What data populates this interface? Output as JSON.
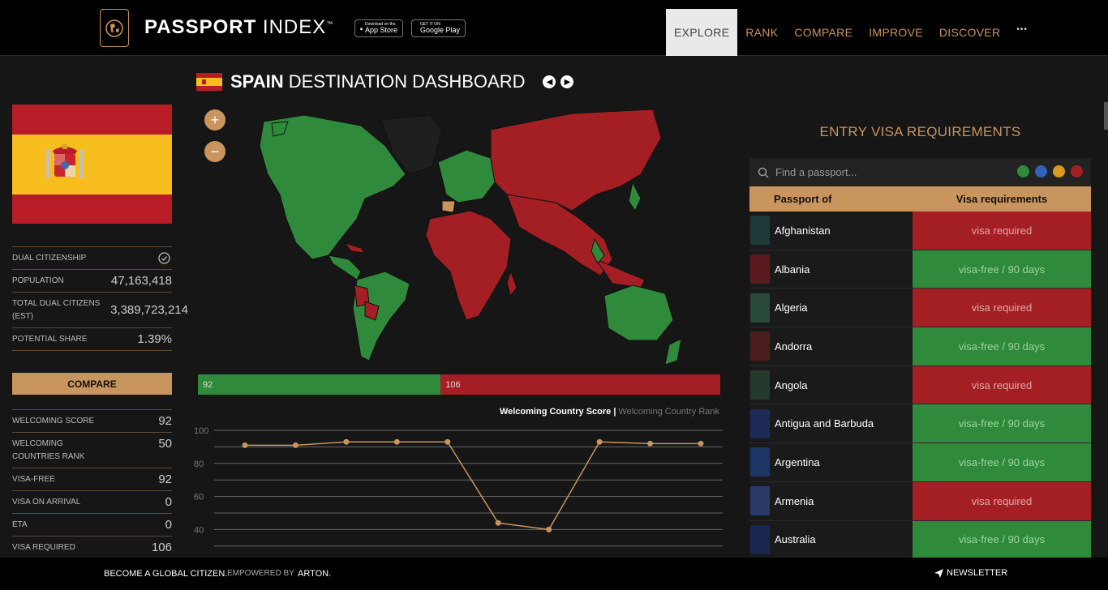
{
  "header": {
    "brand_bold": "PASSPORT",
    "brand_light": "INDEX",
    "brand_mark": "™",
    "app_store": {
      "small": "Download on the",
      "big": "App Store"
    },
    "google_play": {
      "small": "GET IT ON",
      "big": "Google Play"
    },
    "nav": [
      "EXPLORE",
      "RANK",
      "COMPARE",
      "IMPROVE",
      "DISCOVER"
    ],
    "active_nav": "EXPLORE",
    "more": "•••"
  },
  "dashboard": {
    "country": "SPAIN",
    "title_rest": "DESTINATION DASHBOARD"
  },
  "left_panel": {
    "dual_citizenship": {
      "label": "DUAL CITIZENSHIP",
      "icon": "check-circle-icon"
    },
    "population": {
      "label": "POPULATION",
      "value": "47,163,418"
    },
    "total_dual": {
      "label": "TOTAL DUAL CITIZENS (EST)",
      "value": "3,389,723,214"
    },
    "potential_share": {
      "label": "POTENTIAL SHARE",
      "value": "1.39%"
    },
    "compare_button": "COMPARE",
    "welcoming_score": {
      "label": "WELCOMING SCORE",
      "value": "92"
    },
    "welcoming_rank": {
      "label": "WELCOMING COUNTRIES RANK",
      "value": "50"
    },
    "visa_free": {
      "label": "VISA-FREE",
      "value": "92"
    },
    "visa_on_arrival": {
      "label": "VISA ON ARRIVAL",
      "value": "0"
    },
    "eta": {
      "label": "ETA",
      "value": "0"
    },
    "visa_required": {
      "label": "VISA REQUIRED",
      "value": "106"
    }
  },
  "score_bar": {
    "visa_free": 92,
    "visa_required": 106,
    "free_color": "#2f8a3b",
    "req_color": "#a31f24"
  },
  "chart_legend": {
    "active": "Welcoming Country Score",
    "sep": " | ",
    "inactive": "Welcoming Country Rank"
  },
  "chart_data": {
    "type": "line",
    "title": "",
    "y_ticks": [
      "100",
      "80",
      "60",
      "40"
    ],
    "ylim": [
      30,
      100
    ],
    "series": [
      {
        "name": "Welcoming Country Score",
        "values": [
          91,
          91,
          93,
          93,
          93,
          44,
          40,
          93,
          92,
          92
        ]
      }
    ],
    "grid": true
  },
  "right_panel": {
    "title": "ENTRY VISA REQUIREMENTS",
    "search_placeholder": "Find a passport...",
    "filter_colors": [
      "#2f8a3b",
      "#2f62b8",
      "#d99a1f",
      "#a31f24"
    ],
    "col_passport": "Passport of",
    "col_visa": "Visa requirements",
    "rows": [
      {
        "country": "Afghanistan",
        "req": "visa required",
        "type": "required",
        "cover": "#1f3a3a"
      },
      {
        "country": "Albania",
        "req": "visa-free / 90 days",
        "type": "free",
        "cover": "#5a1a1f"
      },
      {
        "country": "Algeria",
        "req": "visa required",
        "type": "required",
        "cover": "#2a4a3a"
      },
      {
        "country": "Andorra",
        "req": "visa-free / 90 days",
        "type": "free",
        "cover": "#4a1e1e"
      },
      {
        "country": "Angola",
        "req": "visa required",
        "type": "required",
        "cover": "#243a2c"
      },
      {
        "country": "Antigua and Barbuda",
        "req": "visa-free / 90 days",
        "type": "free",
        "cover": "#1c2a55"
      },
      {
        "country": "Argentina",
        "req": "visa-free / 90 days",
        "type": "free",
        "cover": "#1d3566"
      },
      {
        "country": "Armenia",
        "req": "visa required",
        "type": "required",
        "cover": "#2a3a66"
      },
      {
        "country": "Australia",
        "req": "visa-free / 90 days",
        "type": "free",
        "cover": "#1a2650"
      }
    ]
  },
  "footer": {
    "slogan": "BECOME A GLOBAL CITIZEN.",
    "empowered": "EMPOWERED BY",
    "arton": "ARTON.",
    "newsletter": "NEWSLETTER"
  }
}
